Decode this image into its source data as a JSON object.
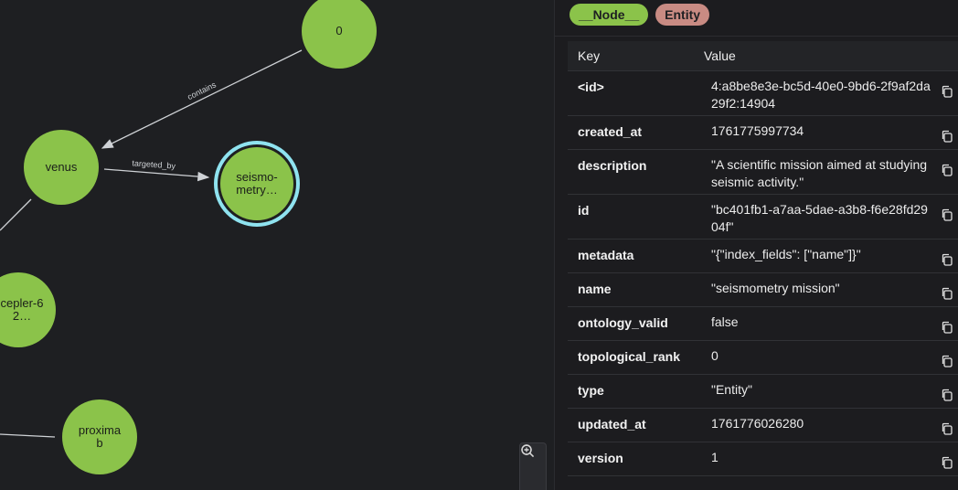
{
  "graph": {
    "nodes": {
      "zero": "0",
      "venus": "venus",
      "seismometry": [
        "seismo-",
        "metry…"
      ],
      "kepler": [
        "cepler-6",
        "2…"
      ],
      "proxima": [
        "proxima",
        "b"
      ]
    },
    "edges": {
      "contains": "contains",
      "targeted_by": "targeted_by"
    },
    "zoom": {
      "zoom_in_icon": "zoom-in",
      "zoom_out_icon": "zoom-out"
    }
  },
  "panel": {
    "labels": [
      "__Node__",
      "Entity"
    ],
    "colors": {
      "node": "#8bc34a",
      "entity": "#c98b83",
      "selected_ring": "#8fe3f0"
    },
    "table": {
      "headers": {
        "key": "Key",
        "value": "Value"
      },
      "rows": [
        {
          "key": "<id>",
          "value": "4:a8be8e3e-bc5d-40e0-9bd6-2f9af2da29f2:14904"
        },
        {
          "key": "created_at",
          "value": "1761775997734"
        },
        {
          "key": "description",
          "value": "\"A scientific mission aimed at studying seismic activity.\""
        },
        {
          "key": "id",
          "value": "\"bc401fb1-a7aa-5dae-a3b8-f6e28fd2904f\""
        },
        {
          "key": "metadata",
          "value": "\"{\"index_fields\": [\"name\"]}\""
        },
        {
          "key": "name",
          "value": "\"seismometry mission\""
        },
        {
          "key": "ontology_valid",
          "value": "false"
        },
        {
          "key": "topological_rank",
          "value": "0"
        },
        {
          "key": "type",
          "value": "\"Entity\""
        },
        {
          "key": "updated_at",
          "value": "1761776026280"
        },
        {
          "key": "version",
          "value": "1"
        }
      ]
    }
  }
}
